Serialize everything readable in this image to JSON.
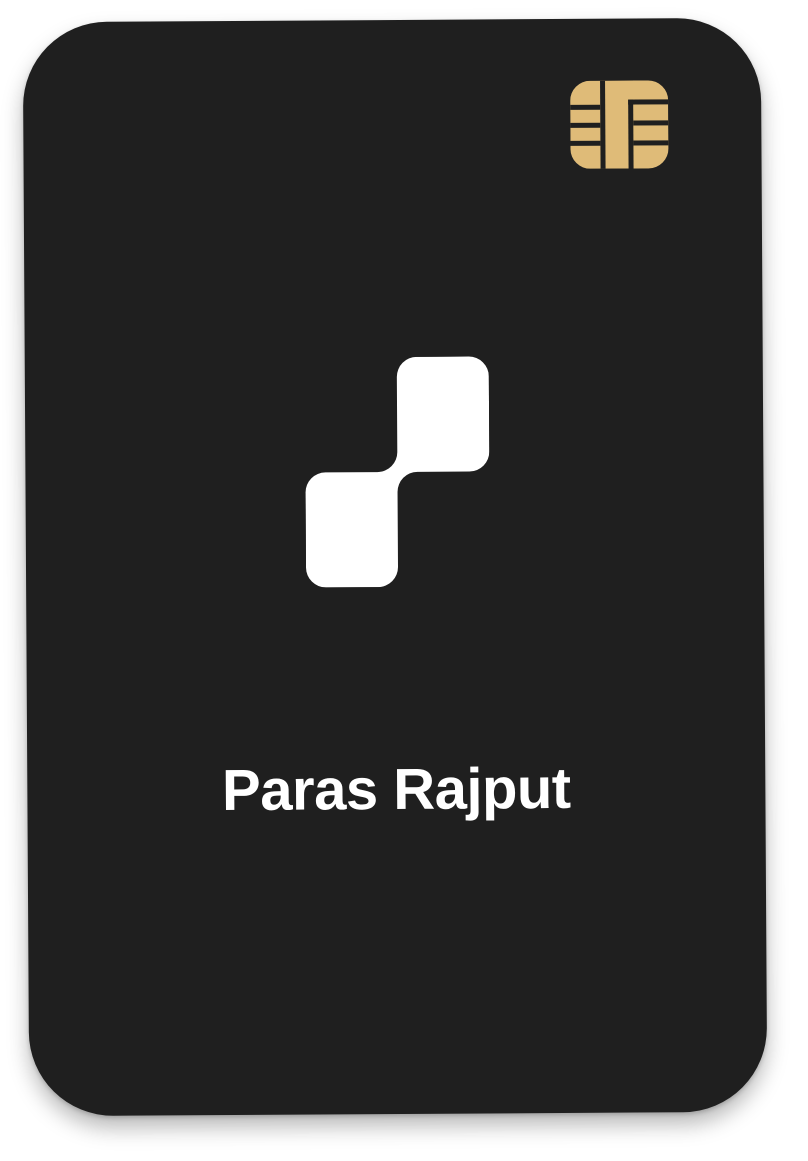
{
  "card": {
    "holder_name": "Paras Rajput",
    "background_color": "#1f1f1f",
    "chip_icon": "emv-chip-icon",
    "chip_color": "#dfbb78",
    "logo_icon": "stacked-squares-logo",
    "logo_color": "#ffffff"
  }
}
